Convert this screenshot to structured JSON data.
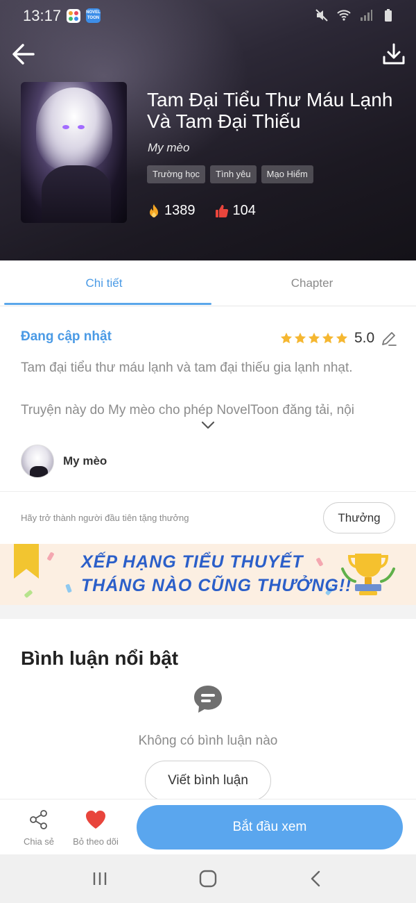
{
  "status_bar": {
    "time": "13:17",
    "app_icons": [
      "app-grid-icon",
      "noveltoon-app-icon"
    ],
    "noveltoon_icon_text": "NOVEL TOON",
    "right_icons": [
      "mute-icon",
      "wifi-icon",
      "signal-icon",
      "battery-icon"
    ]
  },
  "header": {
    "back_icon": "arrow-left-icon",
    "download_icon": "download-icon",
    "title": "Tam Đại Tiểu Thư Máu Lạnh Và Tam Đại Thiếu",
    "author": "My mèo",
    "tags": [
      "Trường học",
      "Tình yêu",
      "Mạo Hiểm"
    ],
    "views": "1389",
    "likes": "104"
  },
  "tabs": {
    "detail": "Chi tiết",
    "chapter": "Chapter",
    "active": "detail"
  },
  "detail": {
    "status": "Đang cập nhật",
    "rating_stars": 5,
    "rating_value": "5.0",
    "description_line1": "Tam đại tiểu thư máu lạnh và tam đại thiếu gia lạnh nhạt.",
    "description_line2": "Truyện này do My mèo cho phép NovelToon đăng tải, nội",
    "author_name": "My mèo",
    "reward_prompt": "Hãy trở thành người đầu tiên tặng thưởng",
    "reward_button": "Thưởng"
  },
  "banner": {
    "line1": "XẾP HẠNG TIỂU THUYẾT",
    "line2": "THÁNG NÀO CŨNG THƯỞNG!!"
  },
  "comments": {
    "title": "Bình luận nổi bật",
    "empty_text": "Không có bình luận nào",
    "write_button": "Viết bình luận"
  },
  "action_bar": {
    "share_label": "Chia sẻ",
    "follow_label": "Bỏ theo dõi",
    "start_button": "Bắt đầu xem"
  },
  "colors": {
    "accent": "#4a9ae5",
    "start_button": "#5aa6ee",
    "heart": "#e8453c",
    "star": "#f5b731"
  }
}
